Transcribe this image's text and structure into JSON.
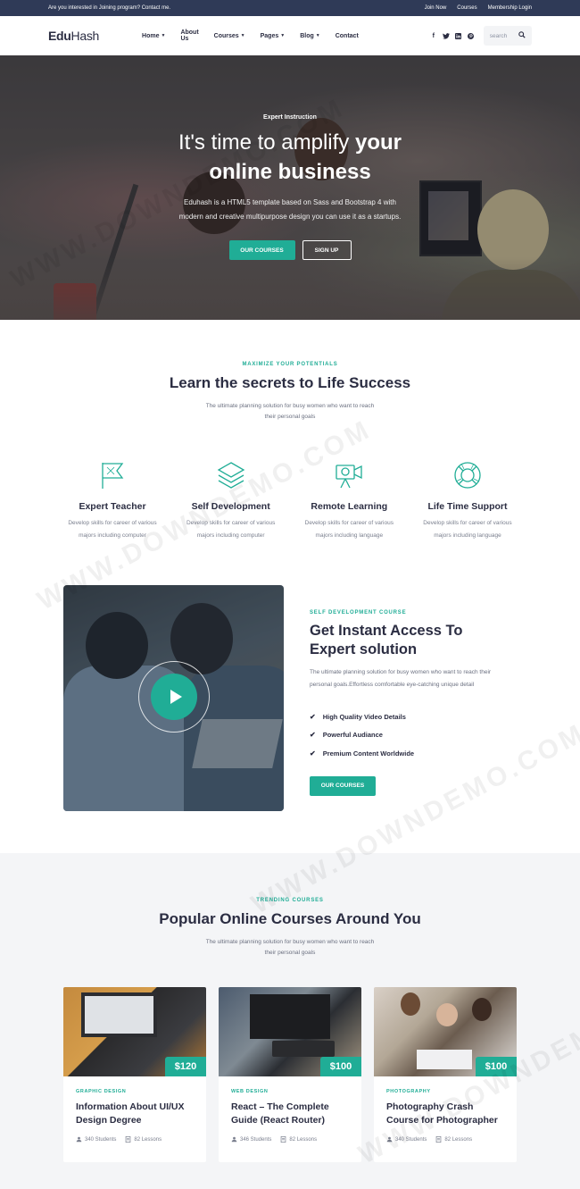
{
  "topbar": {
    "message": "Are you interested in Joining program? Contact me.",
    "links": [
      "Join Now",
      "Courses",
      "Membership Login"
    ]
  },
  "nav": {
    "logo_a": "Edu",
    "logo_b": "Hash",
    "items": [
      "Home",
      "About Us",
      "Courses",
      "Pages",
      "Blog",
      "Contact"
    ],
    "search_placeholder": "search",
    "social": [
      "facebook-icon",
      "twitter-icon",
      "linkedin-icon",
      "pinterest-icon"
    ]
  },
  "hero": {
    "eyebrow": "Expert Instruction",
    "title_line1_normal": "It's time to amplify ",
    "title_line1_bold": "your",
    "title_line2": "online business",
    "desc_line1": "Eduhash is a HTML5 template based on Sass and Bootstrap 4 with",
    "desc_line2": "modern and creative multipurpose design you can use it as a startups.",
    "btn_primary": "OUR COURSES",
    "btn_secondary": "SIGN UP"
  },
  "section1": {
    "eyebrow": "MAXIMIZE YOUR POTENTIALS",
    "title": "Learn the secrets to Life Success",
    "sub_line1": "The ultimate planning solution for busy women who want to reach",
    "sub_line2": "their personal goals",
    "features": [
      {
        "icon": "flag-icon",
        "title": "Expert Teacher",
        "desc1": "Develop skills for career of various",
        "desc2": "majors including computer"
      },
      {
        "icon": "layers-icon",
        "title": "Self Development",
        "desc1": "Develop skills for career of various",
        "desc2": "majors including computer"
      },
      {
        "icon": "video-camera-icon",
        "title": "Remote Learning",
        "desc1": "Develop skills for career of various",
        "desc2": "majors including language"
      },
      {
        "icon": "lifebuoy-icon",
        "title": "Life Time Support",
        "desc1": "Develop skills for career of various",
        "desc2": "majors including language"
      }
    ]
  },
  "section2": {
    "eyebrow": "SELF DEVELOPMENT COURSE",
    "title_line1": "Get Instant Access To",
    "title_line2": "Expert solution",
    "desc_line1": "The ultimate planning solution for busy women who want to reach their",
    "desc_line2": "personal goals.Effortless comfortable eye-catching unique detail",
    "checklist": [
      "High Quality Video Details",
      "Powerful Audiance",
      "Premium Content Worldwide"
    ],
    "btn": "OUR COURSES"
  },
  "section3": {
    "eyebrow": "TRENDING COURSES",
    "title": "Popular Online Courses Around You",
    "sub_line1": "The ultimate planning solution for busy women who want to reach",
    "sub_line2": "their personal goals",
    "courses": [
      {
        "price": "$120",
        "category": "GRAPHIC DESIGN",
        "title_line1": "Information About UI/UX",
        "title_line2": "Design Degree",
        "students": "340 Students",
        "lessons": "82 Lessons"
      },
      {
        "price": "$100",
        "category": "WEB DESIGN",
        "title_line1": "React – The Complete",
        "title_line2": "Guide (React Router)",
        "students": "346 Students",
        "lessons": "82 Lessons"
      },
      {
        "price": "$100",
        "category": "PHOTOGRAPHY",
        "title_line1": "Photography Crash",
        "title_line2": "Course for Photographer",
        "students": "340 Students",
        "lessons": "82 Lessons"
      }
    ]
  },
  "watermark": "WWW.DOWNDEMO.COM",
  "colors": {
    "accent": "#20ad96",
    "dark": "#2b2d42",
    "topbar": "#2f3a57"
  }
}
